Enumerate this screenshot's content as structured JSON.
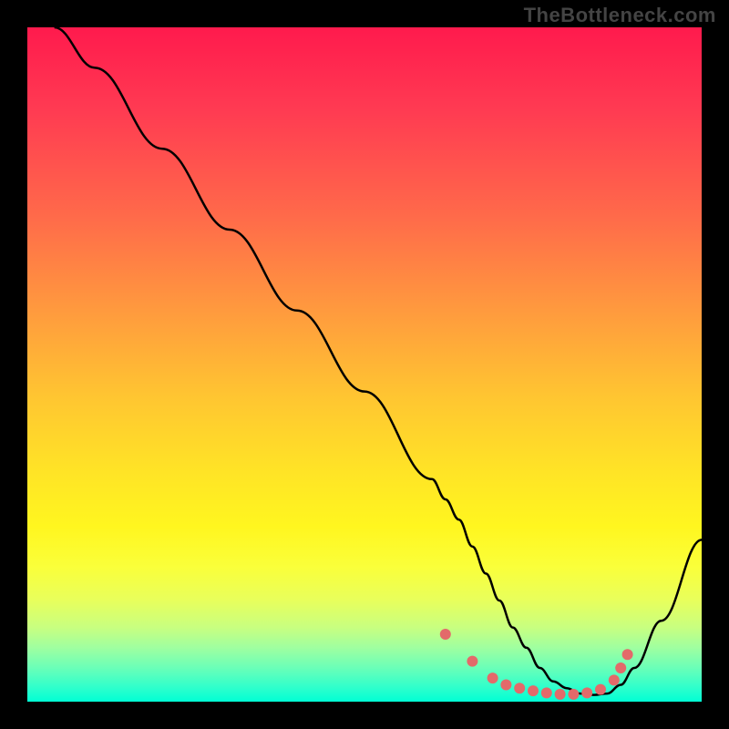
{
  "watermark": "TheBottleneck.com",
  "chart_data": {
    "type": "line",
    "title": "",
    "xlabel": "",
    "ylabel": "",
    "xlim": [
      0,
      100
    ],
    "ylim": [
      0,
      100
    ],
    "series": [
      {
        "name": "curve",
        "x": [
          4,
          10,
          20,
          30,
          40,
          50,
          60,
          62,
          64,
          66,
          68,
          70,
          72,
          74,
          76,
          78,
          80,
          82,
          84,
          86,
          88,
          90,
          94,
          100
        ],
        "values": [
          100,
          94,
          82,
          70,
          58,
          46,
          33,
          30,
          27,
          23,
          19,
          15,
          11,
          8,
          5,
          3,
          2,
          1.2,
          1,
          1.2,
          2.5,
          5,
          12,
          24
        ]
      }
    ],
    "markers": {
      "name": "dots",
      "x": [
        62,
        66,
        69,
        71,
        73,
        75,
        77,
        79,
        81,
        83,
        85,
        87,
        88,
        89
      ],
      "values": [
        10,
        6,
        3.5,
        2.5,
        2,
        1.6,
        1.3,
        1.1,
        1.1,
        1.3,
        1.8,
        3.2,
        5,
        7
      ],
      "color": "#e36a6a",
      "radius": 6
    },
    "background": {
      "type": "vertical-gradient",
      "stops": [
        {
          "pos": 0.0,
          "color": "#ff1a4d"
        },
        {
          "pos": 0.28,
          "color": "#ff6a4a"
        },
        {
          "pos": 0.55,
          "color": "#ffc631"
        },
        {
          "pos": 0.8,
          "color": "#faff3a"
        },
        {
          "pos": 1.0,
          "color": "#00ffd4"
        }
      ]
    }
  }
}
